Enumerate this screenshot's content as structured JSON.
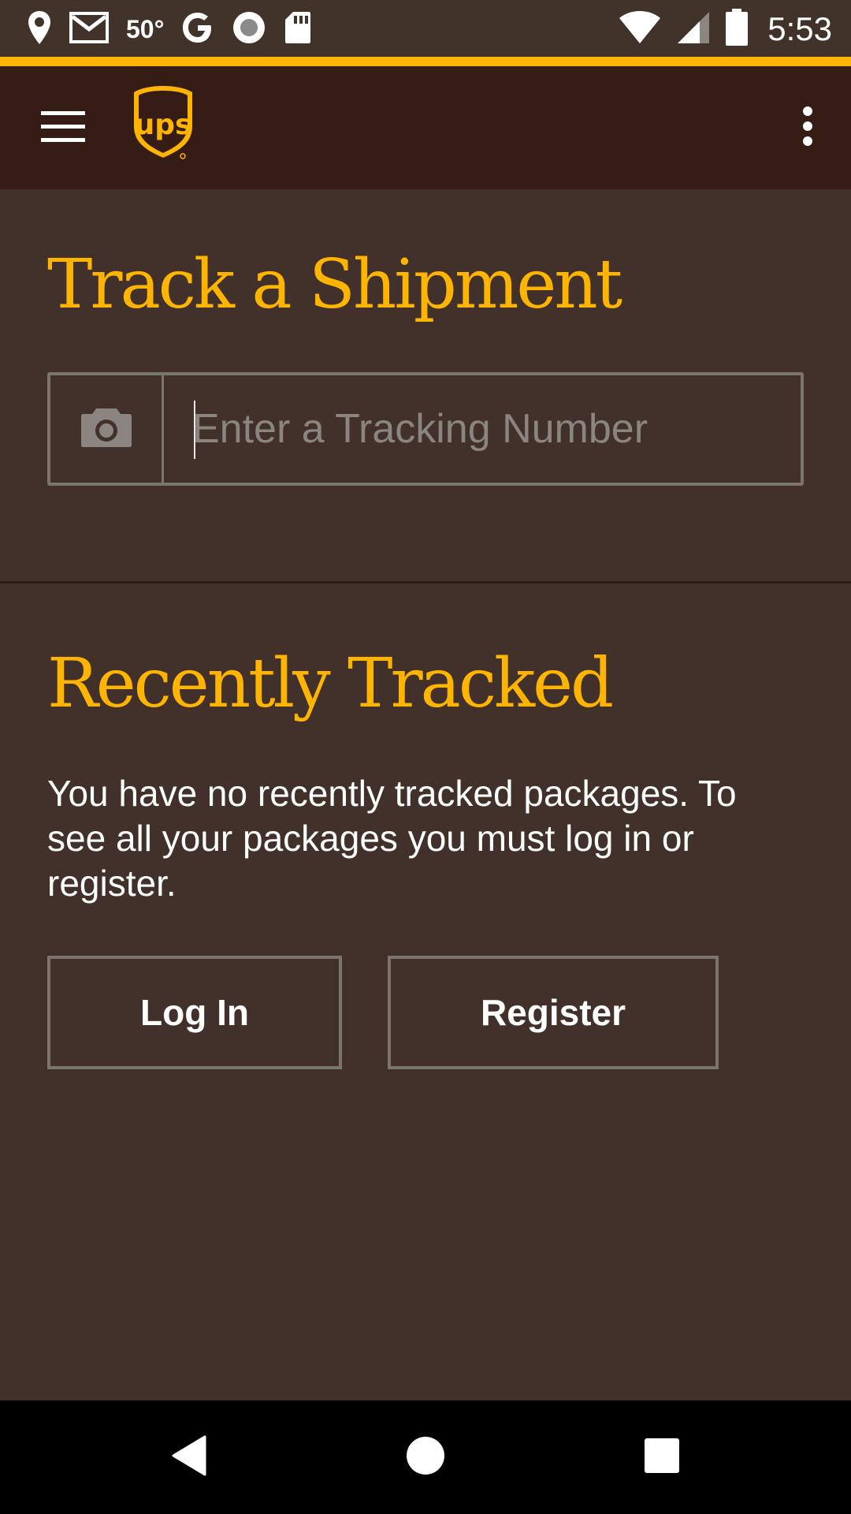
{
  "status_bar": {
    "temperature": "50°",
    "time": "5:53",
    "icons": [
      "location-icon",
      "gmail-icon",
      "google-icon",
      "record-icon",
      "sd-card-icon",
      "wifi-icon",
      "signal-icon",
      "battery-icon"
    ]
  },
  "app_bar": {
    "logo_text": "ups",
    "menu_icon": "hamburger-menu-icon",
    "overflow_icon": "more-vert-icon"
  },
  "track": {
    "title": "Track a Shipment",
    "input_placeholder": "Enter a Tracking Number",
    "input_value": "",
    "camera_icon": "camera-icon"
  },
  "recent": {
    "title": "Recently Tracked",
    "message": "You have no recently tracked packages. To see all your packages you must log in or register.",
    "login_label": "Log In",
    "register_label": "Register"
  },
  "nav_bar": {
    "icons": [
      "back-icon",
      "home-icon",
      "recents-icon"
    ]
  },
  "colors": {
    "accent": "#ffb500",
    "app_bar": "#351c15",
    "background": "#41312a",
    "border": "#7b7570"
  }
}
